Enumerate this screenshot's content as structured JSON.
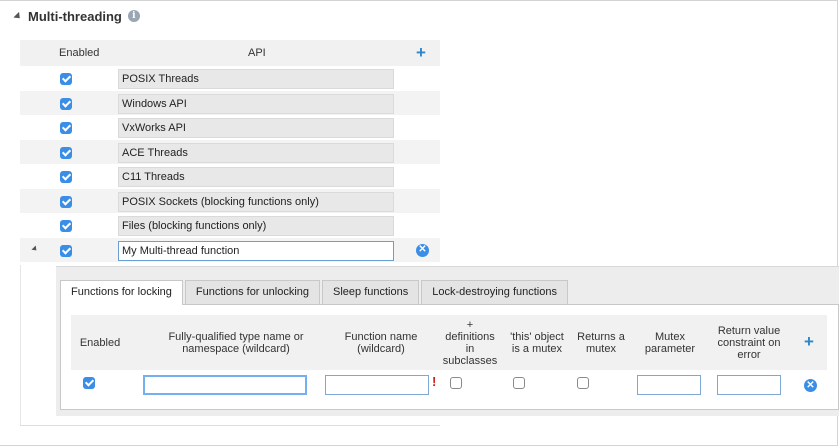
{
  "section": {
    "title": "Multi-threading",
    "info_icon": "info-icon"
  },
  "api_table": {
    "columns": {
      "enabled": "Enabled",
      "api": "API"
    },
    "add_icon": "plus-icon",
    "rows": [
      {
        "enabled": true,
        "name": "POSIX Threads"
      },
      {
        "enabled": true,
        "name": "Windows API"
      },
      {
        "enabled": true,
        "name": "VxWorks API"
      },
      {
        "enabled": true,
        "name": "ACE Threads"
      },
      {
        "enabled": true,
        "name": "C11 Threads"
      },
      {
        "enabled": true,
        "name": "POSIX Sockets (blocking functions only)"
      },
      {
        "enabled": true,
        "name": "Files (blocking functions only)"
      },
      {
        "enabled": true,
        "name": "My Multi-thread function",
        "editable": true,
        "expanded": true
      }
    ],
    "remove_icon": "remove-circle-icon",
    "remove_glyph": "✕"
  },
  "sub_tabs": [
    {
      "label": "Functions for locking",
      "active": true
    },
    {
      "label": "Functions for unlocking",
      "active": false
    },
    {
      "label": "Sleep functions",
      "active": false
    },
    {
      "label": "Lock-destroying functions",
      "active": false
    }
  ],
  "functions_table": {
    "columns": {
      "enabled": "Enabled",
      "type_name": "Fully-qualified type name or namespace (wildcard)",
      "function_name": "Function name (wildcard)",
      "definitions": "+ definitions in subclasses",
      "this_mutex": "'this' object is a mutex",
      "returns_mutex": "Returns a mutex",
      "mutex_param": "Mutex parameter",
      "return_constraint": "Return value constraint on error"
    },
    "row": {
      "enabled": true,
      "type_name": "",
      "function_name": "",
      "definitions": false,
      "this_mutex": false,
      "returns_mutex": false,
      "mutex_param": "",
      "return_constraint": ""
    },
    "warning_mark": "!"
  },
  "glyphs": {
    "plus": "+",
    "info": "i"
  },
  "colors": {
    "accent": "#3a8ee6",
    "warning": "#cc1f1f"
  }
}
